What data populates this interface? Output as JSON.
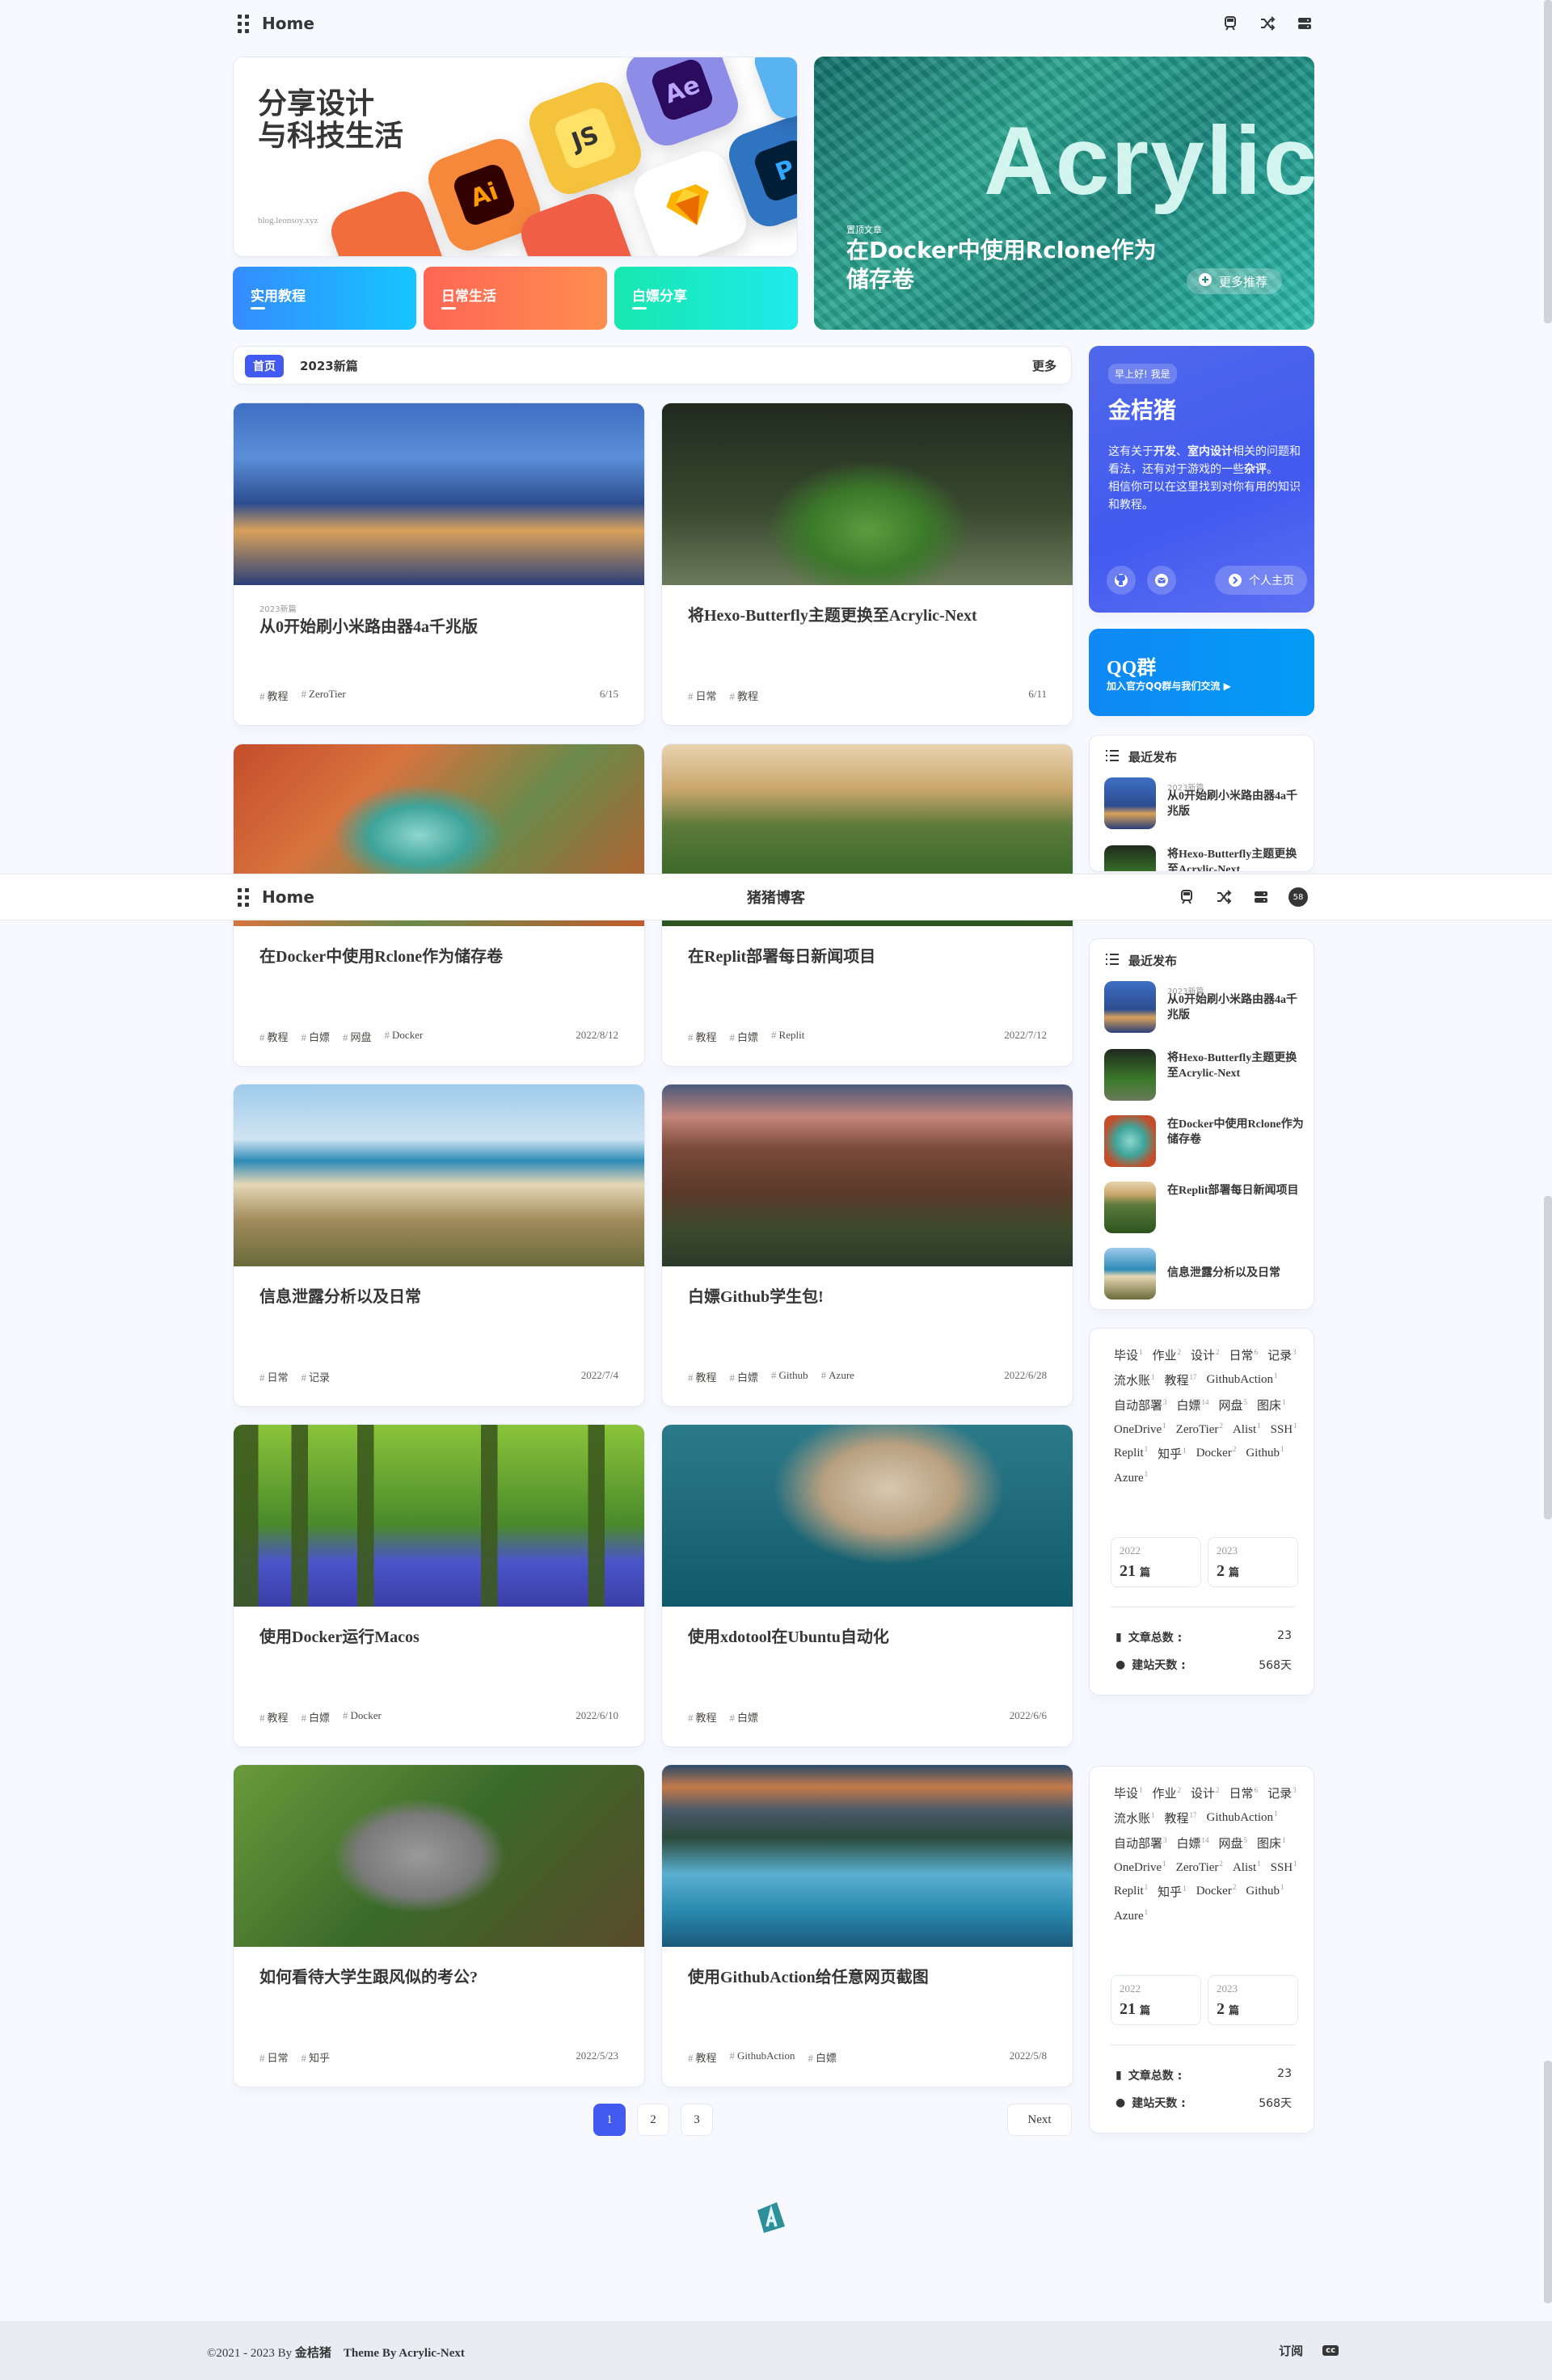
{
  "nav": {
    "title": "Home",
    "site_name": "猪猪博客",
    "avatar_text": "58"
  },
  "hero": {
    "title_line1": "分享设计",
    "title_line2": "与科技生活",
    "subtitle": "blog.leonsoy.xyz",
    "app_icons": [
      "Ai",
      "JS",
      "Ae",
      "P"
    ],
    "categories": [
      "实用教程",
      "日常生活",
      "白嫖分享"
    ],
    "feature_label": "置顶文章",
    "feature_bg_text": "Acrylic",
    "feature_title": "在Docker中使用Rclone作为储存卷",
    "feature_more": "更多推荐"
  },
  "crumb": {
    "tag": "首页",
    "name": "2023新篇",
    "more": "更多"
  },
  "posts": [
    {
      "kicker": "2023新篇",
      "title": "从0开始刷小米路由器4a千兆版",
      "tags": [
        "教程",
        "ZeroTier"
      ],
      "date": "6/15"
    },
    {
      "kicker": "",
      "title": "将Hexo-Butterfly主题更换至Acrylic-Next",
      "tags": [
        "日常",
        "教程"
      ],
      "date": "6/11"
    },
    {
      "kicker": "",
      "title": "在Docker中使用Rclone作为储存卷",
      "tags": [
        "教程",
        "白嫖",
        "网盘",
        "Docker"
      ],
      "date": "2022/8/12"
    },
    {
      "kicker": "",
      "title": "在Replit部署每日新闻项目",
      "tags": [
        "教程",
        "白嫖",
        "Replit"
      ],
      "date": "2022/7/12"
    },
    {
      "kicker": "",
      "title": "信息泄露分析以及日常",
      "tags": [
        "日常",
        "记录"
      ],
      "date": "2022/7/4"
    },
    {
      "kicker": "",
      "title": "白嫖Github学生包!",
      "tags": [
        "教程",
        "白嫖",
        "Github",
        "Azure"
      ],
      "date": "2022/6/28"
    },
    {
      "kicker": "",
      "title": "使用Docker运行Macos",
      "tags": [
        "教程",
        "白嫖",
        "Docker"
      ],
      "date": "2022/6/10"
    },
    {
      "kicker": "",
      "title": "使用xdotool在Ubuntu自动化",
      "tags": [
        "教程",
        "白嫖"
      ],
      "date": "2022/6/6"
    },
    {
      "kicker": "",
      "title": "如何看待大学生跟风似的考公?",
      "tags": [
        "日常",
        "知乎"
      ],
      "date": "2022/5/23"
    },
    {
      "kicker": "",
      "title": "使用GithubAction给任意网页截图",
      "tags": [
        "教程",
        "GithubAction",
        "白嫖"
      ],
      "date": "2022/5/8"
    }
  ],
  "author": {
    "hello": "早上好! 我是",
    "name": "金桔猪",
    "desc1": "这有关于",
    "desc_b1": "开发",
    "desc2": "、",
    "desc_b2": "室内设计",
    "desc3": "相关的问题和看法，还有对于游戏的一些",
    "desc_b3": "杂评",
    "desc4": "。",
    "desc5": "相信你可以在这里找到对你有用的知识和教程。",
    "home_btn": "个人主页"
  },
  "qq": {
    "title": "QQ群",
    "sub": "加入官方QQ群与我们交流 ▶"
  },
  "recent": {
    "heading": "最近发布",
    "items": [
      {
        "kicker": "2023新篇",
        "title": "从0开始刷小米路由器4a千兆版"
      },
      {
        "kicker": "",
        "title": "将Hexo-Butterfly主题更换至Acrylic-Next"
      },
      {
        "kicker": "",
        "title": "在Docker中使用Rclone作为储存卷"
      },
      {
        "kicker": "",
        "title": "在Replit部署每日新闻项目"
      },
      {
        "kicker": "",
        "title": "信息泄露分析以及日常"
      }
    ]
  },
  "tags": [
    {
      "n": "毕设",
      "c": "1"
    },
    {
      "n": "作业",
      "c": "2"
    },
    {
      "n": "设计",
      "c": "2"
    },
    {
      "n": "日常",
      "c": "6"
    },
    {
      "n": "记录",
      "c": "3"
    },
    {
      "n": "流水账",
      "c": "1"
    },
    {
      "n": "教程",
      "c": "17"
    },
    {
      "n": "GithubAction",
      "c": "1"
    },
    {
      "n": "自动部署",
      "c": "3"
    },
    {
      "n": "白嫖",
      "c": "14"
    },
    {
      "n": "网盘",
      "c": "5"
    },
    {
      "n": "图床",
      "c": "1"
    },
    {
      "n": "OneDrive",
      "c": "1"
    },
    {
      "n": "ZeroTier",
      "c": "2"
    },
    {
      "n": "Alist",
      "c": "1"
    },
    {
      "n": "SSH",
      "c": "1"
    },
    {
      "n": "Replit",
      "c": "1"
    },
    {
      "n": "知乎",
      "c": "1"
    },
    {
      "n": "Docker",
      "c": "2"
    },
    {
      "n": "Github",
      "c": "1"
    },
    {
      "n": "Azure",
      "c": "1"
    }
  ],
  "archive": [
    {
      "year": "2022",
      "count": "21",
      "unit": "篇"
    },
    {
      "year": "2023",
      "count": "2",
      "unit": "篇"
    }
  ],
  "stats": [
    {
      "label": "文章总数 :",
      "value": "23"
    },
    {
      "label": "建站天数 :",
      "value": "568天"
    }
  ],
  "pager": {
    "pages": [
      "1",
      "2",
      "3"
    ],
    "next": "Next"
  },
  "footer": {
    "copy": "©2021 - 2023 By",
    "author": "金桔猪",
    "theme": "Theme By Acrylic-Next",
    "subscribe": "订阅",
    "cc": "cc"
  },
  "colors": {
    "accent": "#425aef",
    "qq": "#0f88f5"
  }
}
